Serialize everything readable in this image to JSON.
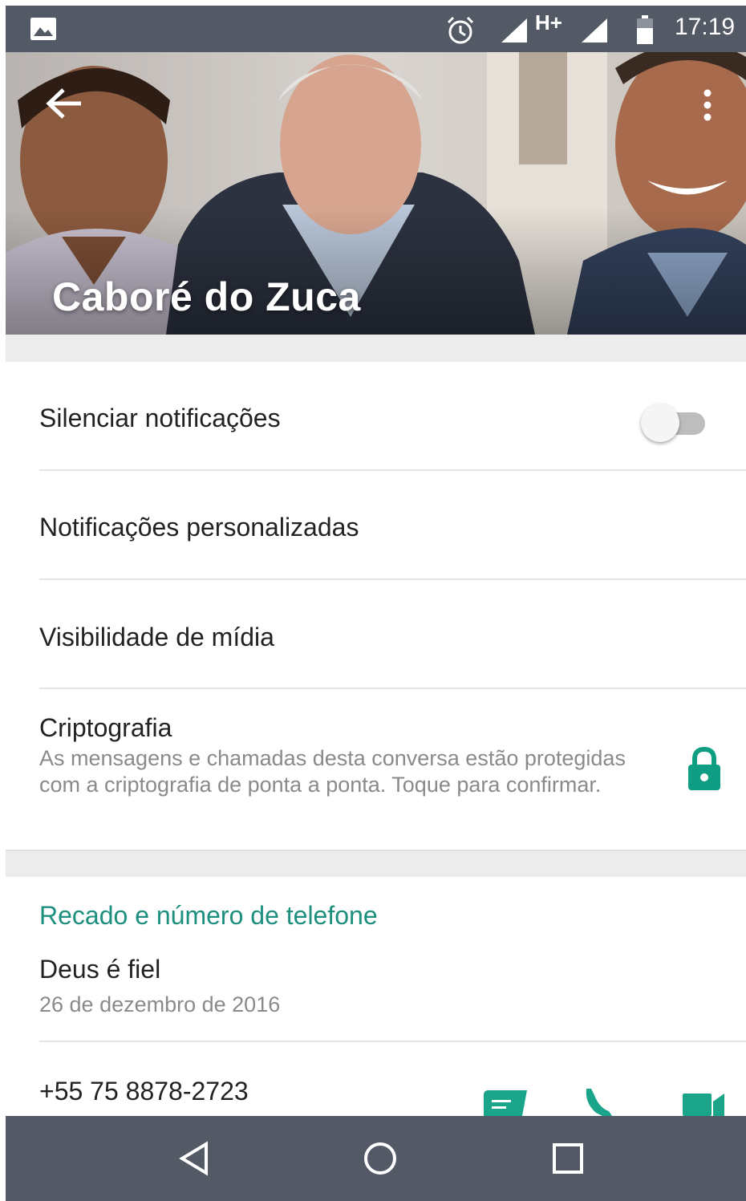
{
  "status_bar": {
    "network": "H+",
    "time": "17:19",
    "icons": [
      "gallery-icon",
      "alarm-icon",
      "signal-icon",
      "signal-icon",
      "battery-icon"
    ]
  },
  "header": {
    "contact_name": "Caboré do Zuca",
    "back_icon": "arrow-left-icon",
    "menu_icon": "more-vert-icon"
  },
  "settings": {
    "mute_label": "Silenciar notificações",
    "mute_enabled": false,
    "custom_notifications_label": "Notificações personalizadas",
    "media_visibility_label": "Visibilidade de mídia",
    "encryption_title": "Criptografia",
    "encryption_description": "As mensagens e chamadas desta conversa estão protegidas com a criptografia de ponta a ponta. Toque para confirmar.",
    "encryption_icon": "lock-icon"
  },
  "about": {
    "section_title": "Recado e número de telefone",
    "status": "Deus é fiel",
    "status_date": "26 de dezembro de 2016",
    "phone_number": "+55 75 8878-2723",
    "actions": [
      "message-icon",
      "phone-icon",
      "video-icon"
    ]
  },
  "colors": {
    "status_bar": "#535a66",
    "accent_teal": "#1d8f7e",
    "lock": "#0f9d84",
    "action_icon": "#1aa58b"
  },
  "nav_bar": {
    "icons": [
      "back-triangle-icon",
      "home-circle-icon",
      "recents-square-icon"
    ]
  }
}
